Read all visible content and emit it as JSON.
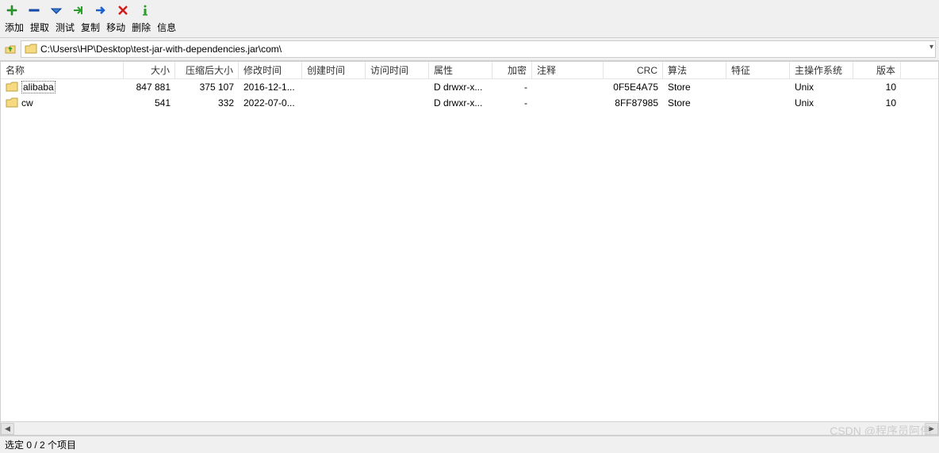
{
  "toolbar": {
    "labels": [
      "添加",
      "提取",
      "测试",
      "复制",
      "移动",
      "删除",
      "信息"
    ]
  },
  "path": "C:\\Users\\HP\\Desktop\\test-jar-with-dependencies.jar\\com\\",
  "columns": {
    "name": "名称",
    "size": "大小",
    "packed": "压缩后大小",
    "modified": "修改时间",
    "created": "创建时间",
    "accessed": "访问时间",
    "attr": "属性",
    "enc": "加密",
    "comment": "注释",
    "crc": "CRC",
    "method": "算法",
    "char": "特征",
    "os": "主操作系统",
    "ver": "版本"
  },
  "rows": [
    {
      "name": "alibaba",
      "size": "847 881",
      "packed": "375 107",
      "modified": "2016-12-1...",
      "created": "",
      "accessed": "",
      "attr": "D drwxr-x...",
      "enc": "-",
      "comment": "",
      "crc": "0F5E4A75",
      "method": "Store",
      "char": "",
      "os": "Unix",
      "ver": "10"
    },
    {
      "name": "cw",
      "size": "541",
      "packed": "332",
      "modified": "2022-07-0...",
      "created": "",
      "accessed": "",
      "attr": "D drwxr-x...",
      "enc": "-",
      "comment": "",
      "crc": "8FF87985",
      "method": "Store",
      "char": "",
      "os": "Unix",
      "ver": "10"
    }
  ],
  "status": "选定 0 / 2 个项目",
  "watermark": "CSDN @程序员阿伟"
}
